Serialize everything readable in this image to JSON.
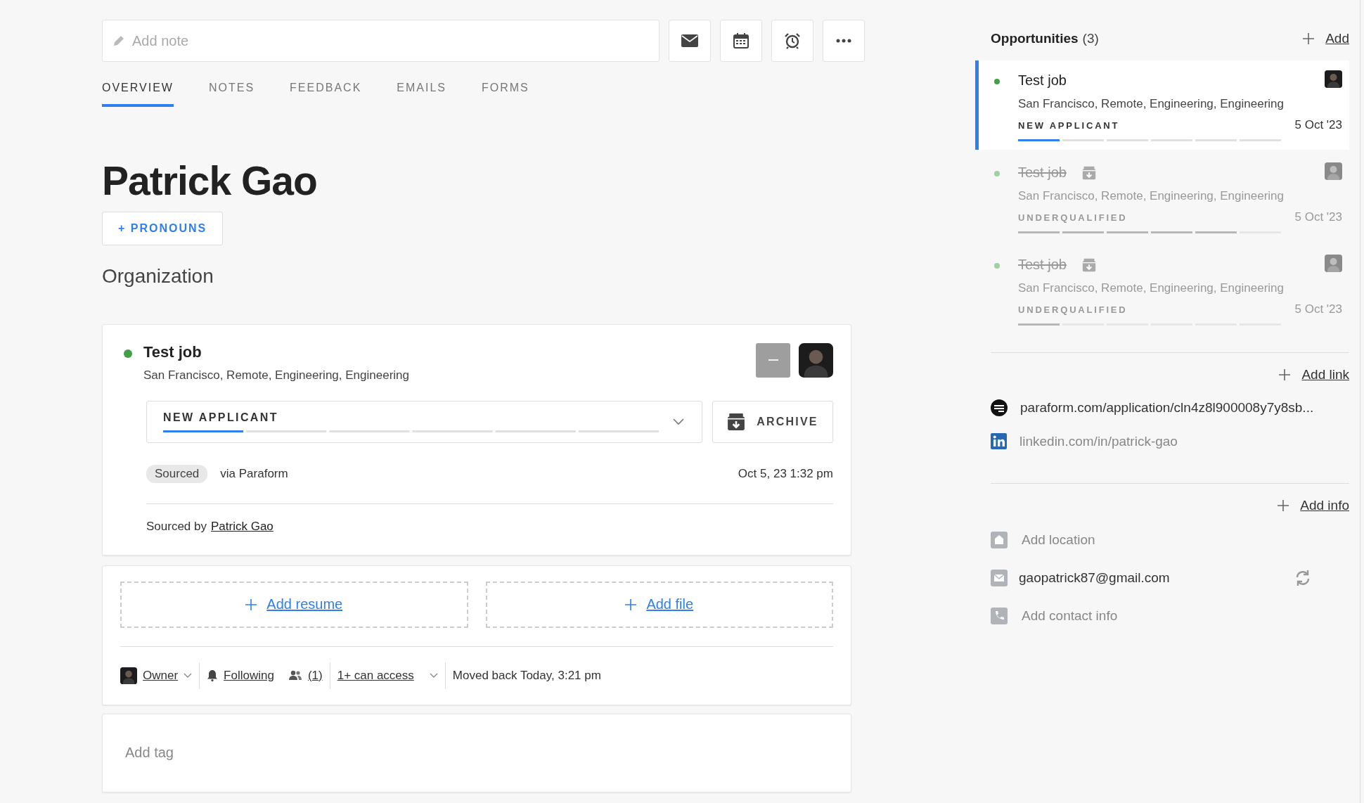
{
  "note_field": {
    "placeholder": "Add note"
  },
  "tabs": [
    {
      "label": "OVERVIEW",
      "selected": true
    },
    {
      "label": "NOTES",
      "selected": false
    },
    {
      "label": "FEEDBACK",
      "selected": false
    },
    {
      "label": "EMAILS",
      "selected": false
    },
    {
      "label": "FORMS",
      "selected": false
    }
  ],
  "candidate": {
    "name": "Patrick Gao",
    "pronouns_button": "+ PRONOUNS",
    "organization": "Organization"
  },
  "application": {
    "title": "Test job",
    "location": "San Francisco, Remote, Engineering, Engineering",
    "stage": "NEW APPLICANT",
    "level": 0.1667,
    "archive_button": "ARCHIVE",
    "source_tag": "Sourced",
    "source_via": "via Paraform",
    "date": "Oct 5, 23 1:32 pm",
    "sourced_by_label": "Sourced by",
    "sourced_by": "Patrick Gao"
  },
  "files": {
    "add_resume": "Add resume",
    "add_file": "Add file"
  },
  "meta": {
    "owner": "Owner",
    "following": "Following",
    "followers": "(1)",
    "access": "1+ can access",
    "moved": "Moved back Today, 3:21 pm"
  },
  "tag_field": {
    "placeholder": "Add tag"
  },
  "opportunities": {
    "title": "Opportunities",
    "count": "(3)",
    "add": "Add",
    "items": [
      {
        "title": "Test job",
        "location": "San Francisco, Remote, Engineering, Engineering",
        "stage": "NEW APPLICANT",
        "date": "5 Oct '23",
        "level": 0.1667,
        "archived": false,
        "selected": true
      },
      {
        "title": "Test job",
        "location": "San Francisco, Remote, Engineering, Engineering",
        "stage": "UNDERQUALIFIED",
        "date": "5 Oct '23",
        "level": 0.8333,
        "archived": true,
        "selected": false
      },
      {
        "title": "Test job",
        "location": "San Francisco, Remote, Engineering, Engineering",
        "stage": "UNDERQUALIFIED",
        "date": "5 Oct '23",
        "level": 0.1667,
        "archived": true,
        "selected": false
      }
    ]
  },
  "links": {
    "add": "Add link",
    "items": [
      {
        "kind": "paraform",
        "text": "paraform.com/application/cln4z8l900008y7y8sb...",
        "muted": false
      },
      {
        "kind": "linkedin",
        "text": "linkedin.com/in/patrick-gao",
        "muted": true
      }
    ]
  },
  "info": {
    "add": "Add info",
    "items": [
      {
        "kind": "location",
        "text": "Add location",
        "empty": true
      },
      {
        "kind": "email",
        "text": "gaopatrick87@gmail.com",
        "empty": false
      },
      {
        "kind": "phone",
        "text": "Add contact info",
        "empty": true
      }
    ]
  }
}
